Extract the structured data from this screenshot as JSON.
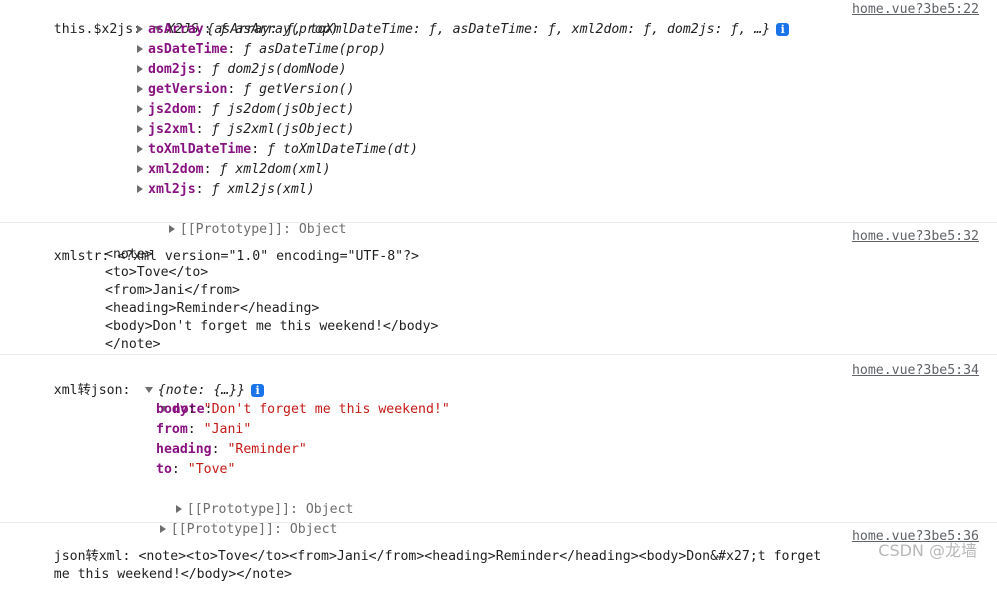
{
  "entry1": {
    "label": "this.$x2js:",
    "summary": "X2JS {asArray: ƒ, toXmlDateTime: ƒ, asDateTime: ƒ, xml2dom: ƒ, dom2js: ƒ, …}",
    "source": "home.vue?3be5:22",
    "props": [
      {
        "key": "asArray",
        "sep": ": ",
        "val": "ƒ asArray(prop)"
      },
      {
        "key": "asDateTime",
        "sep": ": ",
        "val": "ƒ asDateTime(prop)"
      },
      {
        "key": "dom2js",
        "sep": ": ",
        "val": "ƒ dom2js(domNode)"
      },
      {
        "key": "getVersion",
        "sep": ": ",
        "val": "ƒ getVersion()"
      },
      {
        "key": "js2dom",
        "sep": ": ",
        "val": "ƒ js2dom(jsObject)"
      },
      {
        "key": "js2xml",
        "sep": ": ",
        "val": "ƒ js2xml(jsObject)"
      },
      {
        "key": "toXmlDateTime",
        "sep": ": ",
        "val": "ƒ toXmlDateTime(dt)"
      },
      {
        "key": "xml2dom",
        "sep": ": ",
        "val": "ƒ xml2dom(xml)"
      },
      {
        "key": "xml2js",
        "sep": ": ",
        "val": "ƒ xml2js(xml)"
      }
    ],
    "prototype": "[[Prototype]]: Object"
  },
  "entry2": {
    "label": "xmlstr:",
    "first_line": "<?xml version=\"1.0\" encoding=\"UTF-8\"?>",
    "lines": [
      "<note>",
      "<to>Tove</to>",
      "<from>Jani</from>",
      "<heading>Reminder</heading>",
      "<body>Don't forget me this weekend!</body>",
      "</note>"
    ],
    "source": "home.vue?3be5:32"
  },
  "entry3": {
    "label": "xml转json:",
    "summary": "{note: {…}}",
    "source": "home.vue?3be5:34",
    "note_key": "note",
    "props": [
      {
        "key": "body",
        "val": "\"Don't forget me this weekend!\""
      },
      {
        "key": "from",
        "val": "\"Jani\""
      },
      {
        "key": "heading",
        "val": "\"Reminder\""
      },
      {
        "key": "to",
        "val": "\"Tove\""
      }
    ],
    "inner_prototype": "[[Prototype]]: Object",
    "outer_prototype": "[[Prototype]]: Object"
  },
  "entry4": {
    "label": "json转xml:",
    "line1": "<note><to>Tove</to><from>Jani</from><heading>Reminder</heading><body>Don&#x27;t forget",
    "line2": "me this weekend!</body></note>",
    "source": "home.vue?3be5:36"
  },
  "watermark": "CSDN @龙墙",
  "colors": {
    "key": "#881280",
    "string": "#c41a16",
    "info": "#1a73e8",
    "source": "#5f6368"
  }
}
